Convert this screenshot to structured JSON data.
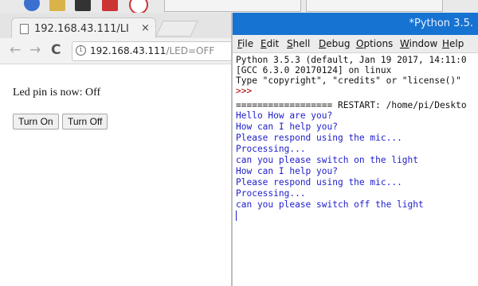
{
  "browser": {
    "tab_title": "192.168.43.111/Lİ",
    "tab_close": "×",
    "nav_back": "←",
    "nav_forward": "→",
    "nav_reload": "C",
    "info_icon": "i",
    "url_host": "192.168.43.111",
    "url_path": "/LED=OFF"
  },
  "page": {
    "status_text": "Led pin is now: Off",
    "button_on": "Turn On",
    "button_off": "Turn Off"
  },
  "shell": {
    "window_title": "*Python 3.5.",
    "menu": [
      "File",
      "Edit",
      "Shell",
      "Debug",
      "Options",
      "Window",
      "Help"
    ],
    "lines": [
      "Python 3.5.3 (default, Jan 19 2017, 14:11:0",
      "[GCC 6.3.0 20170124] on linux",
      "Type \"copyright\", \"credits\" or \"license()\"",
      ">>> ",
      "================== RESTART: /home/pi/Deskto",
      "Hello How are you?",
      "How can I help you?",
      "Please respond using the mic...",
      "Processing...",
      "can you please switch on the light",
      "How can I help you?",
      "Please respond using the mic...",
      "Processing...",
      "can you please switch off the light"
    ]
  },
  "colors": {
    "shell_titlebar": "#1773d1",
    "shell_output": "#1d1dcc",
    "shell_prompt": "#b00000"
  }
}
